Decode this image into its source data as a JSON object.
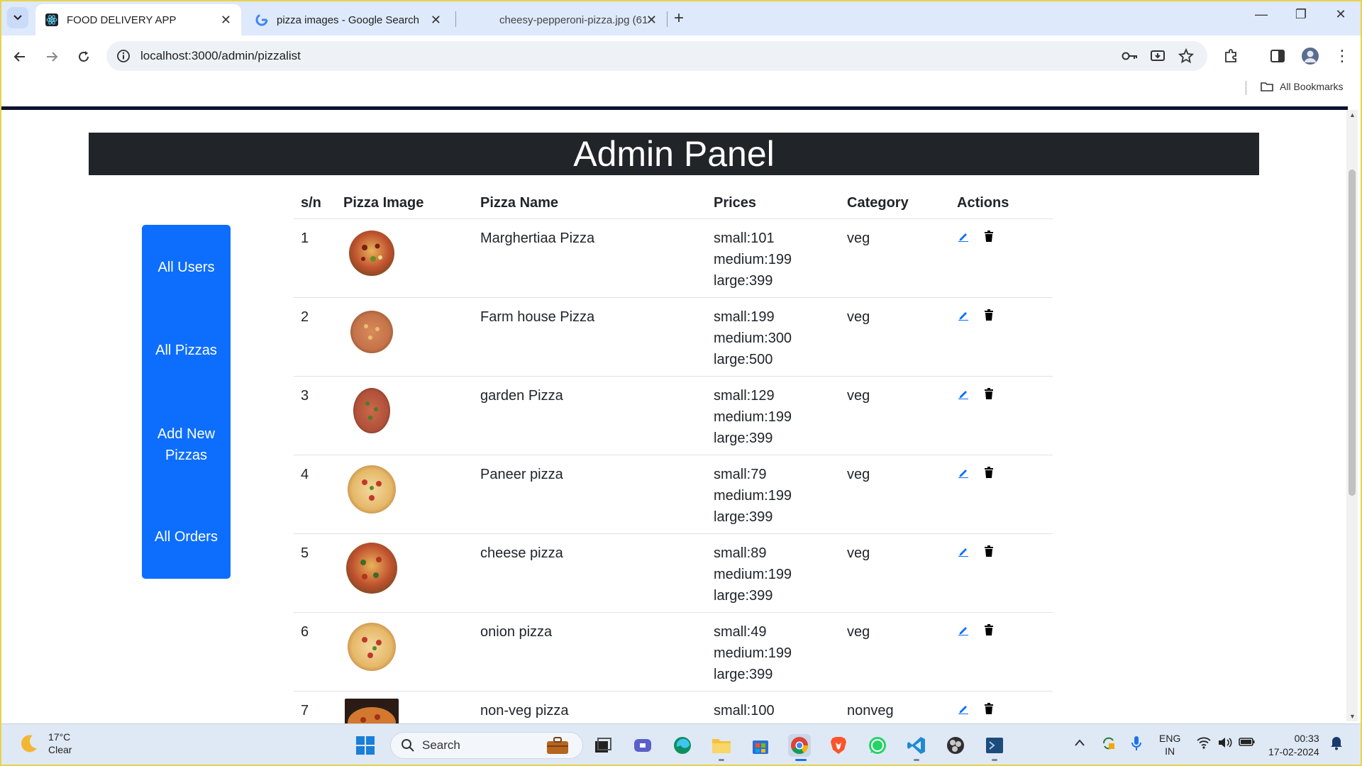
{
  "browser": {
    "tabs": [
      {
        "title": "FOOD DELIVERY APP",
        "active": true
      },
      {
        "title": "pizza images - Google Search",
        "active": false
      },
      {
        "title": "cheesy-pepperoni-pizza.jpg (61",
        "active": false
      }
    ],
    "url": "localhost:3000/admin/pizzalist",
    "bookmarks_label": "All Bookmarks"
  },
  "page": {
    "header_title": "Admin Panel",
    "sidebar": [
      "All Users",
      "All Pizzas",
      "Add New Pizzas",
      "All Orders"
    ],
    "table": {
      "columns": [
        "s/n",
        "Pizza Image",
        "Pizza Name",
        "Prices",
        "Category",
        "Actions"
      ],
      "rows": [
        {
          "sn": "1",
          "name": "Marghertiaa Pizza",
          "small": "small:101",
          "medium": "medium:199",
          "large": "large:399",
          "category": "veg"
        },
        {
          "sn": "2",
          "name": "Farm house Pizza",
          "small": "small:199",
          "medium": "medium:300",
          "large": "large:500",
          "category": "veg"
        },
        {
          "sn": "3",
          "name": "garden Pizza",
          "small": "small:129",
          "medium": "medium:199",
          "large": "large:399",
          "category": "veg"
        },
        {
          "sn": "4",
          "name": "Paneer pizza",
          "small": "small:79",
          "medium": "medium:199",
          "large": "large:399",
          "category": "veg"
        },
        {
          "sn": "5",
          "name": "cheese pizza",
          "small": "small:89",
          "medium": "medium:199",
          "large": "large:399",
          "category": "veg"
        },
        {
          "sn": "6",
          "name": "onion pizza",
          "small": "small:49",
          "medium": "medium:199",
          "large": "large:399",
          "category": "veg"
        },
        {
          "sn": "7",
          "name": "non-veg pizza",
          "small": "small:100",
          "medium": "",
          "large": "",
          "category": "nonveg"
        }
      ]
    }
  },
  "taskbar": {
    "weather_temp": "17°C",
    "weather_desc": "Clear",
    "search_label": "Search",
    "lang_1": "ENG",
    "lang_2": "IN",
    "time": "00:33",
    "date": "17-02-2024"
  },
  "colors": {
    "accent": "#0d6efd",
    "header_bg": "#212529",
    "tabstrip": "#dee9fb"
  }
}
